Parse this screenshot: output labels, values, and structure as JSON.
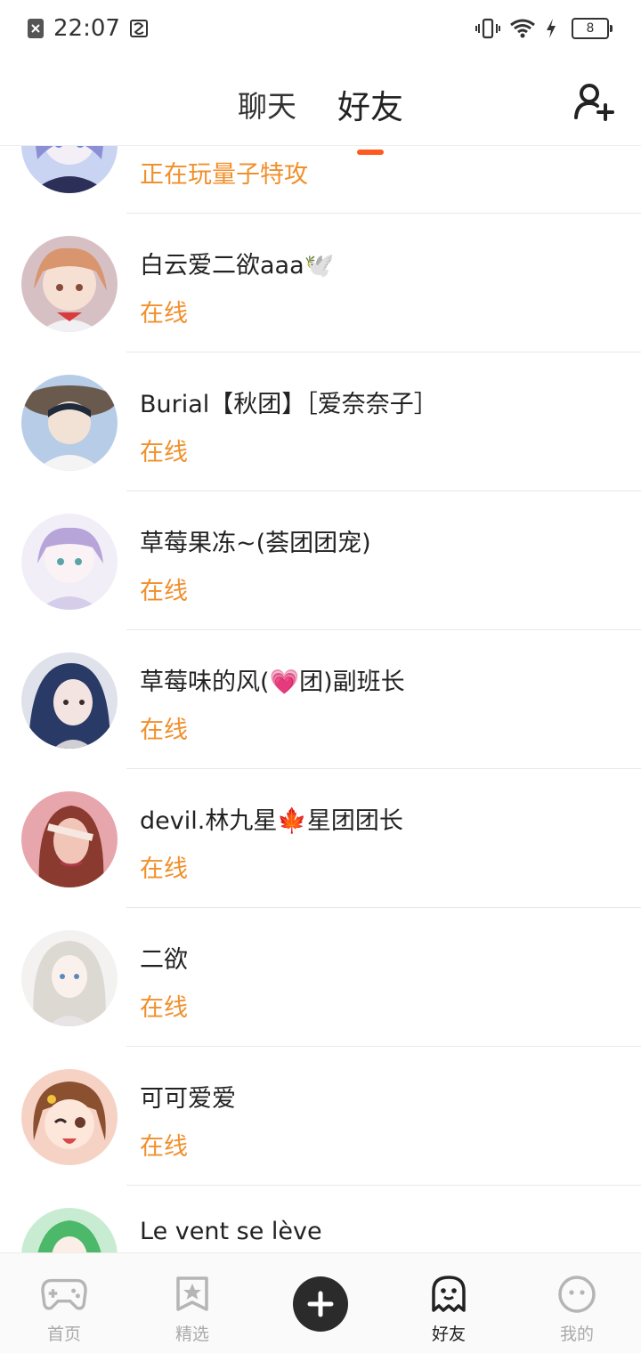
{
  "status_bar": {
    "time": "22:07",
    "battery": "8"
  },
  "header": {
    "tabs": [
      {
        "label": "聊天",
        "active": false
      },
      {
        "label": "好友",
        "active": true
      }
    ],
    "add_friend_icon": "add-friend-icon"
  },
  "friends": [
    {
      "name": "",
      "status": "正在玩量子特攻",
      "avatar_color": "#c9d3f2"
    },
    {
      "name": "白云爱二欲aaa🕊️",
      "status": "在线",
      "avatar_color": "#e9b7a3"
    },
    {
      "name": "Burial【秋团】［爱奈奈子］",
      "status": "在线",
      "avatar_color": "#b7cce6"
    },
    {
      "name": "草莓果冻~(荟团团宠)",
      "status": "在线",
      "avatar_color": "#d9d0ec"
    },
    {
      "name": "草莓味的风(💗团)副班长",
      "status": "在线",
      "avatar_color": "#3d4a6b"
    },
    {
      "name": "devil.林九星🍁星团团长",
      "status": "在线",
      "avatar_color": "#e7a6ac"
    },
    {
      "name": "二欲",
      "status": "在线",
      "avatar_color": "#e6e3df"
    },
    {
      "name": "可可爱爱",
      "status": "在线",
      "avatar_color": "#f3c4b4"
    },
    {
      "name": "Le vent se lève",
      "status": "",
      "avatar_color": "#7fcf8a"
    }
  ],
  "bottom_nav": [
    {
      "label": "首页",
      "icon": "gamepad-icon",
      "active": false
    },
    {
      "label": "精选",
      "icon": "star-bookmark-icon",
      "active": false
    },
    {
      "label": "",
      "icon": "plus-icon",
      "active": false
    },
    {
      "label": "好友",
      "icon": "ghost-icon",
      "active": true
    },
    {
      "label": "我的",
      "icon": "face-icon",
      "active": false
    }
  ],
  "colors": {
    "accent": "#ff5a1f",
    "status_text": "#f0902c"
  }
}
